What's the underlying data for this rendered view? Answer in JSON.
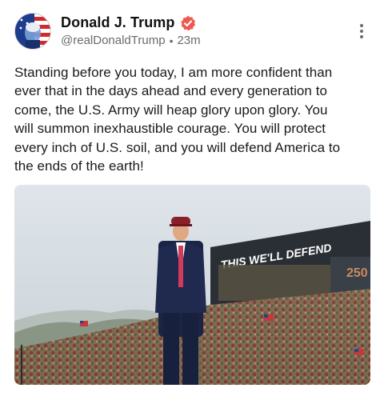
{
  "author": {
    "display_name": "Donald J. Trump",
    "handle": "@realDonaldTrump",
    "separator": "•",
    "time_ago": "23m",
    "avatar_icon": "avatar-flag-portrait",
    "verified_icon": "verified-badge-icon",
    "verified_color": "#f05a4f"
  },
  "post": {
    "text": "Standing before you today, I am more confident than\never that in the days ahead and every generation to\ncome, the U.S. Army will heap glory upon glory. You\nwill summon inexhaustible courage. You will protect\nevery inch of U.S. soil, and you will defend America to\nthe ends of the earth!",
    "menu_icon": "more-vertical-icon"
  },
  "media": {
    "banner_text": "THIS WE'LL DEFEND",
    "banner_number": "250"
  }
}
